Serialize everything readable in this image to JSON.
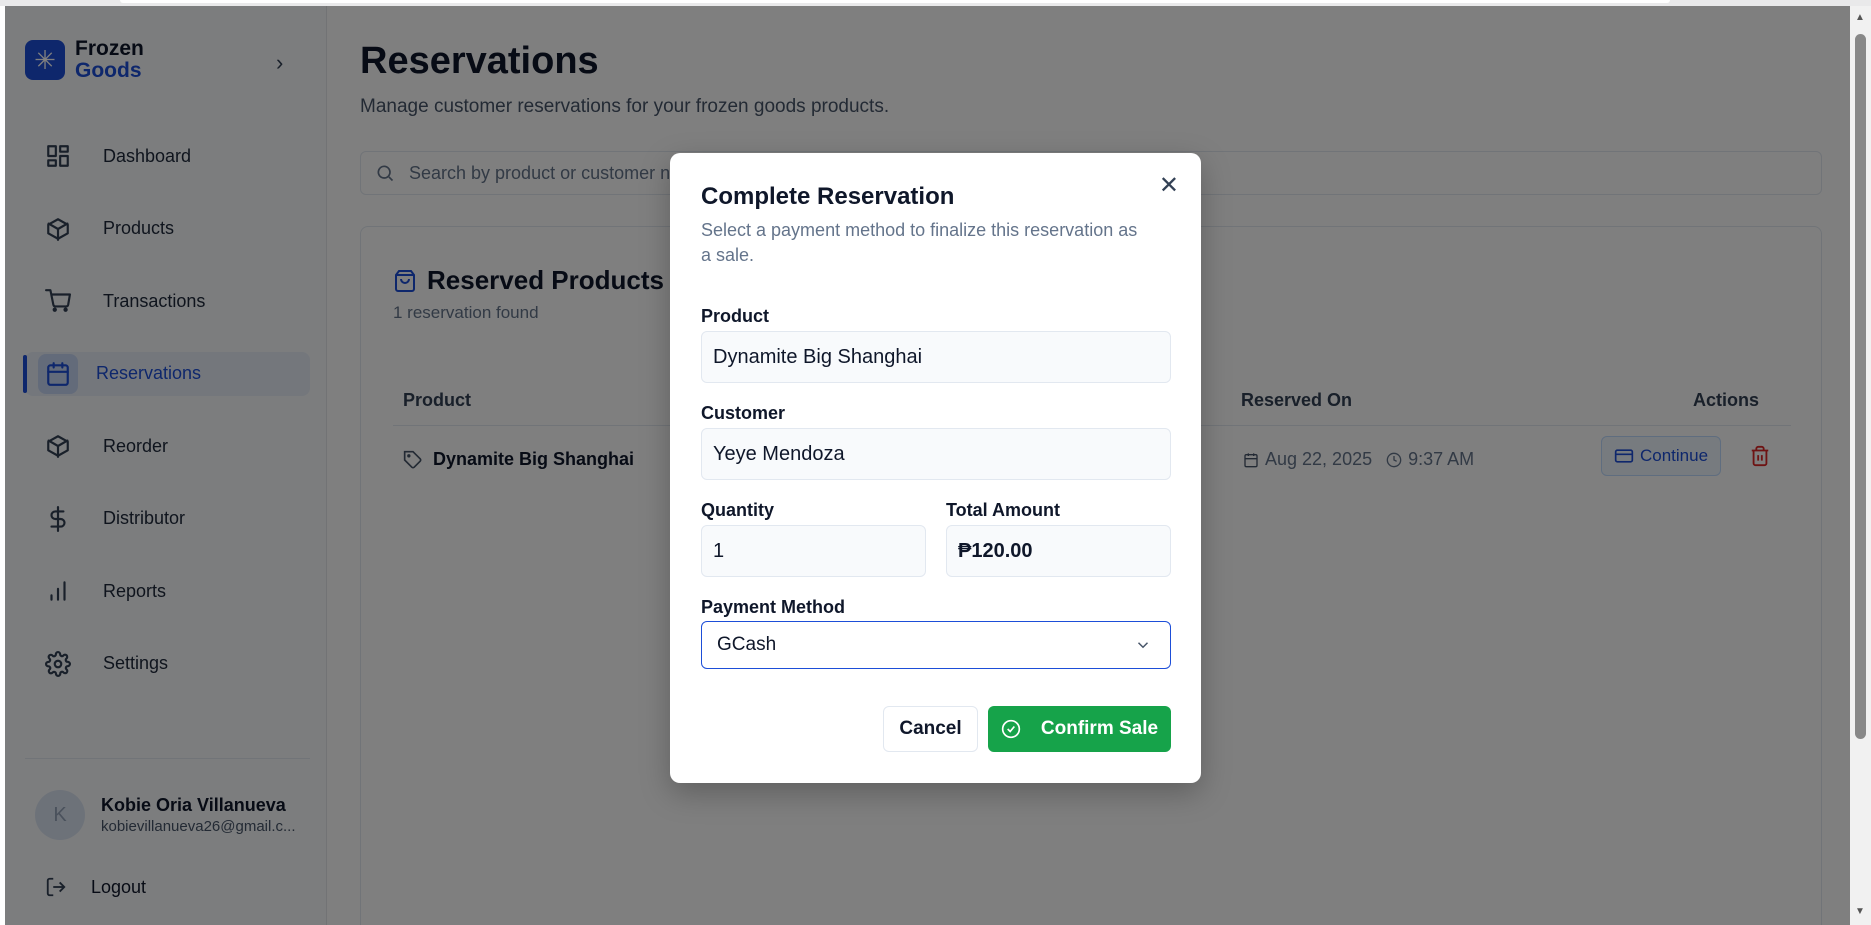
{
  "brand": {
    "line1": "Frozen",
    "line2": "Goods",
    "logo_icon": "snowflake-icon",
    "accent": "#1d4ed8"
  },
  "sidebar": {
    "items": [
      {
        "label": "Dashboard",
        "icon": "dashboard-icon"
      },
      {
        "label": "Products",
        "icon": "box-icon"
      },
      {
        "label": "Transactions",
        "icon": "cart-icon"
      },
      {
        "label": "Reservations",
        "icon": "calendar-icon",
        "active": true
      },
      {
        "label": "Reorder",
        "icon": "box-icon"
      },
      {
        "label": "Distributor",
        "icon": "dollar-icon"
      },
      {
        "label": "Reports",
        "icon": "bar-chart-icon"
      },
      {
        "label": "Settings",
        "icon": "gear-icon"
      }
    ],
    "user": {
      "initial": "K",
      "name": "Kobie Oria Villanueva",
      "email": "kobievillanueva26@gmail.c..."
    },
    "logout_label": "Logout"
  },
  "page": {
    "title": "Reservations",
    "subtitle": "Manage customer reservations for your frozen goods products.",
    "search_placeholder": "Search by product or customer name..."
  },
  "card": {
    "title": "Reserved Products",
    "subtitle": "1 reservation found",
    "columns": {
      "product": "Product",
      "reserved_on": "Reserved On",
      "actions": "Actions"
    },
    "rows": [
      {
        "product": "Dynamite Big Shanghai",
        "date": "Aug 22, 2025",
        "time": "9:37 AM",
        "continue_label": "Continue"
      }
    ]
  },
  "modal": {
    "title": "Complete Reservation",
    "description": "Select a payment method to finalize this reservation as a sale.",
    "product_label": "Product",
    "product_value": "Dynamite Big Shanghai",
    "customer_label": "Customer",
    "customer_value": "Yeye Mendoza",
    "quantity_label": "Quantity",
    "quantity_value": "1",
    "total_label": "Total Amount",
    "total_value": "₱120.00",
    "payment_label": "Payment Method",
    "payment_value": "GCash",
    "cancel_label": "Cancel",
    "confirm_label": "Confirm Sale",
    "confirm_color": "#16a34a"
  }
}
